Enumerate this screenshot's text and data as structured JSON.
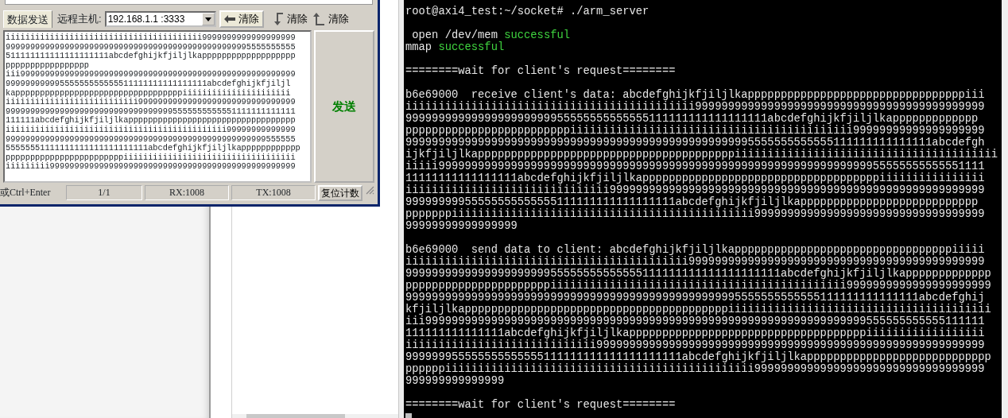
{
  "serial_window": {
    "tab": "数据发送",
    "remote_host_label": "远程主机:",
    "remote_host": "192.168.1.1  :3333",
    "clear_buttons": [
      {
        "kind": "left",
        "label": "清除"
      },
      {
        "kind": "down",
        "label": "清除"
      },
      {
        "kind": "up",
        "label": "清除"
      }
    ],
    "send_text": [
      "iiiiiiiiiiiiiiiiiiiiiiiiiiiiiiiiiiiiiiii9999999999999999999",
      "99999999999999999999999999999999999999999999999995555555555",
      "511111111111111111111abcdefghijkfjiljlkappppppppppppppppppp",
      "ppppppppppppppppp",
      "iii99999999999999999999999999999999999999999999999999999999",
      "99999999999555555555555511111111111111111abcdefghijkfjiljl",
      "kappppppppppppppppppppppppppppppppppiiiiiiiiiiiiiiiiiiiiii",
      "iiiiiiiiiiiiiiiiiiiiiiiiiii99999999999999999999999999999999",
      "99999999999999999999999999999999995555555555551111111111111",
      "111111abcdefghijkfjiljlkapppppppppppppppppppppppppppppppppp",
      "iiiiiiiiiiiiiiiiiiiiiiiiiiiiiiiiiiiiiiiiiiiii99999999999999",
      "99999999999999999999999999999999999999999999999999999555555",
      "55555551111111111111111111111abcdefghijkfjiljlkapppppppppppp",
      "ppppppppppppppppppppppppiiiiiiiiiiiiiiiiiiiiiiiiiiiiiiiiiii",
      "iiiiiiiii99999999999999999999999999999999999999999999999999"
    ],
    "send_button": "发送",
    "status_bar": {
      "hint": "或Ctrl+Enter",
      "page": "1/1",
      "rx": "RX:1008",
      "tx": "TX:1008",
      "reset_button": "复位计数"
    }
  },
  "terminal": {
    "blocks": [
      [
        "root@axi4_test:~/socket# ./arm_server"
      ],
      [
        {
          "segments": [
            {
              "text": " open /dev/mem ",
              "kind": "plain"
            },
            {
              "text": "successful",
              "kind": "success"
            }
          ]
        },
        {
          "segments": [
            {
              "text": "mmap ",
              "kind": "plain"
            },
            {
              "text": "successful",
              "kind": "success"
            }
          ]
        }
      ],
      [
        "========wait for client's request========"
      ],
      [
        "b6e69000  receive client's data: abcdefghijkfjiljlkapppppppppppppppppppppppppppppppppiii",
        "iiiiiiiiiiiiiiiiiiiiiiiiiiiiiiiiiiiiiiiiiiii99999999999999999999999999999999999999999999",
        "9999999999999999999999955555555555555111111111111111111abcdefghijkfjiljlkappppppppppppp",
        "pppppppppppppppppppppppppiiiiiiiiiiiiiiiiiiiiiiiiiiiiiiiiiiiiiiiiiii99999999999999999999",
        "99999999999999999999999999999999999999999999999999995555555555555111111111111111abcdefgh",
        "ijkfjiljlkapppppppppppppppppppppppppppppppppppppppiiiiiiiiiiiiiiiiiiiiiiiiiiiiiiiiiiiiiiii",
        "iiiii99999999999999999999999999999999999999999999999999999999999999999955555555555551111",
        "11111111111111111abcdefghijkfjiljlkappppppppppppppppppppppppppppppppppppiiiiiiiiiiiiiiii",
        "iiiiiiiiiiiiiiiiiiiiiiiiiiiiiii999999999999999999999999999999999999999999999999999999999",
        "99999999955555555555555111111111111111111abcdefghijkfjiljlkappppppppppppppppppppppppppp",
        "pppppppiiiiiiiiiiiiiiiiiiiiiiiiiiiiiiiiiiiiiiiiiiiiii99999999999999999999999999999999999",
        "99999999999999999"
      ],
      [
        "b6e69000  send data to client: abcdefghijkfjiljlkapppppppppppppppppppppppppppppppppiiiii",
        "iiiiiiiiiiiiiiiiiiiiiiiiiiiiiiiiiiiiiiiiiii999999999999999999999999999999999999999999999",
        "999999999999999999999955555555555555111111111111111111111abcdefghijkfjiljlkappppppppppppp",
        "ppppppppppppppppppppppiiiiiiiiiiiiiiiiiiiiiiiiiiiiiiiiiiiiiiiiiiiii9999999999999999999999",
        "999999999999999999999999999999999999999999999999995555555555555111111111111111abcdefghij",
        "kfjiljlkappppppppppppppppppppppppppppppppppppppppiiiiiiiiiiiiiiiiiiiiiiiiiiiiiiiiiiiiiiii",
        "iii9999999999999999999999999999999999999999999999999999999999999999999555555555555111111",
        "111111111111111abcdefghijkfjiljlkappppppppppppppppppppppppppppppppppppiiiiiiiiiiiiiiiiii",
        "iiiiiiiiiiiiiiiiiiiiiiiiiiiii99999999999999999999999999999999999999999999999999999999999",
        "999999955555555555555111111111111111111111abcdefghijkfjiljlkapppppppppppppppppppppppppppp",
        "ppppppiiiiiiiiiiiiiiiiiiiiiiiiiiiiiiiiiiiiiiiiiiiiiii99999999999999999999999999999999999",
        "999999999999999"
      ],
      [
        "========wait for client's request========"
      ]
    ]
  }
}
